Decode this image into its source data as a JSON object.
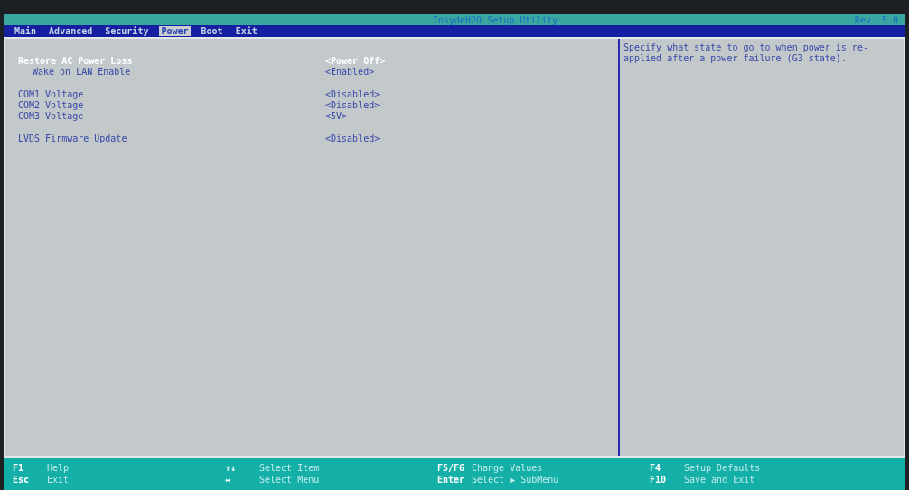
{
  "window": {
    "title": "InsydeH2O Setup Utility",
    "revision": "Rev. 5.0"
  },
  "tabs": [
    {
      "label": "Main",
      "selected": false
    },
    {
      "label": "Advanced",
      "selected": false
    },
    {
      "label": "Security",
      "selected": false
    },
    {
      "label": "Power",
      "selected": true
    },
    {
      "label": "Boot",
      "selected": false
    },
    {
      "label": "Exit",
      "selected": false
    }
  ],
  "settings": [
    [
      {
        "label": "Restore AC Power Loss",
        "value": "<Power Off>",
        "selected": true,
        "indented": false
      },
      {
        "label": "Wake on LAN Enable",
        "value": "<Enabled>",
        "selected": false,
        "indented": true
      }
    ],
    [
      {
        "label": "COM1 Voltage",
        "value": "<Disabled>",
        "selected": false,
        "indented": false
      },
      {
        "label": "COM2 Voltage",
        "value": "<Disabled>",
        "selected": false,
        "indented": false
      },
      {
        "label": "COM3 Voltage",
        "value": "<5V>",
        "selected": false,
        "indented": false
      }
    ],
    [
      {
        "label": "LVDS Firmware Update",
        "value": "<Disabled>",
        "selected": false,
        "indented": false
      }
    ]
  ],
  "help": "Specify what state to go to when power is re-applied after a power failure (G3 state).",
  "keys": [
    [
      {
        "key": "F1",
        "action": "Help"
      },
      {
        "key": "Esc",
        "action": "Exit"
      }
    ],
    [
      {
        "key": "↑↓",
        "action": "Select Item"
      },
      {
        "key": "↔",
        "action": "Select Menu"
      }
    ],
    [
      {
        "key": "F5/F6",
        "action": "Change Values"
      },
      {
        "key": "Enter",
        "action": "Select ▶ SubMenu"
      }
    ],
    [
      {
        "key": "F4",
        "action": "Setup Defaults"
      },
      {
        "key": "F10",
        "action": "Save and Exit"
      }
    ]
  ]
}
